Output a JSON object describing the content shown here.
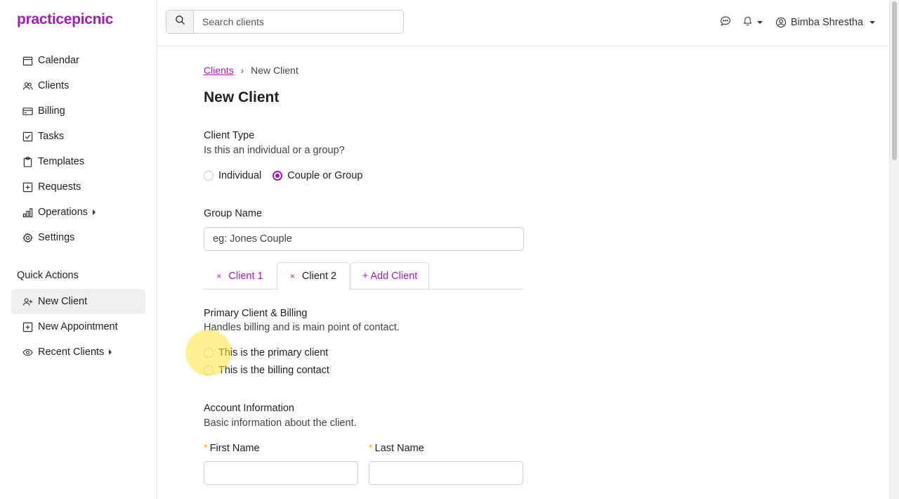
{
  "app": {
    "logo": "practicepicnic",
    "brand_color": "#a21caf"
  },
  "sidebar": {
    "items": [
      {
        "label": "Calendar",
        "icon": "calendar-icon"
      },
      {
        "label": "Clients",
        "icon": "users-icon"
      },
      {
        "label": "Billing",
        "icon": "credit-card-icon"
      },
      {
        "label": "Tasks",
        "icon": "checkbox-icon"
      },
      {
        "label": "Templates",
        "icon": "clipboard-icon"
      },
      {
        "label": "Requests",
        "icon": "plus-square-icon"
      },
      {
        "label": "Operations",
        "icon": "bar-chart-icon",
        "expandable": true
      },
      {
        "label": "Settings",
        "icon": "gear-icon"
      }
    ],
    "quick_actions_title": "Quick Actions",
    "quick_actions": [
      {
        "label": "New Client",
        "icon": "user-plus-icon",
        "active": true
      },
      {
        "label": "New Appointment",
        "icon": "plus-square-icon"
      },
      {
        "label": "Recent Clients",
        "icon": "eye-icon",
        "expandable": true
      }
    ]
  },
  "topbar": {
    "search_placeholder": "Search clients",
    "user_name": "Bimba Shrestha"
  },
  "breadcrumb": {
    "parent": "Clients",
    "separator": "›",
    "current": "New Client"
  },
  "page_title": "New Client",
  "client_type": {
    "title": "Client Type",
    "subtitle": "Is this an individual or a group?",
    "options": [
      "Individual",
      "Couple or Group"
    ],
    "selected": "Couple or Group"
  },
  "group_name": {
    "label": "Group Name",
    "placeholder": "eg: Jones Couple"
  },
  "tabs": [
    {
      "label": "Client 1",
      "closable": true,
      "active": false
    },
    {
      "label": "Client 2",
      "closable": true,
      "active": true
    },
    {
      "label": "+ Add Client",
      "closable": false,
      "active": false
    }
  ],
  "tab_close_glyph": "×",
  "primary_billing": {
    "title": "Primary Client & Billing",
    "subtitle": "Handles billing and is main point of contact.",
    "options": [
      "This is the primary client",
      "This is the billing contact"
    ]
  },
  "account_info": {
    "title": "Account Information",
    "subtitle": "Basic information about the client.",
    "required_mark": "*",
    "first_name_label": "First Name",
    "last_name_label": "Last Name"
  }
}
